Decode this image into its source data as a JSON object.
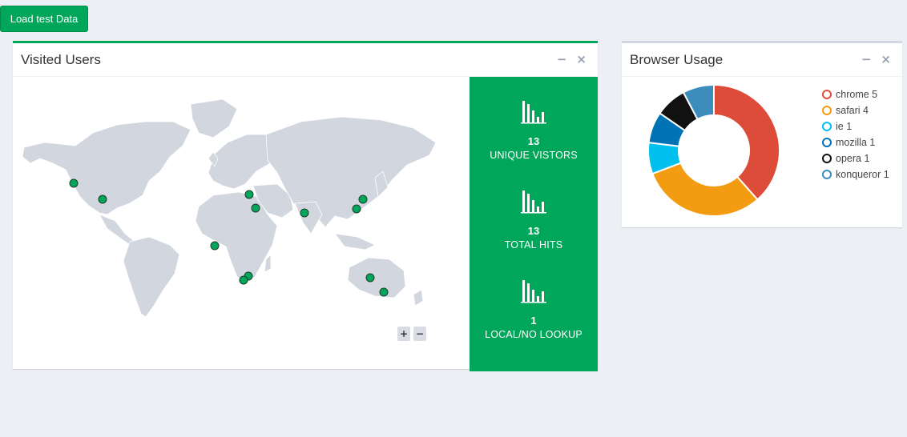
{
  "toolbar": {
    "load_label": "Load test Data"
  },
  "visited": {
    "title": "Visited Users",
    "minimize": "−",
    "close": "×",
    "zoom_in": "+",
    "zoom_out": "−",
    "stats": [
      {
        "value": "13",
        "label": "UNIQUE VISTORS"
      },
      {
        "value": "13",
        "label": "TOTAL HITS"
      },
      {
        "value": "1",
        "label": "LOCAL/NO LOOKUP"
      }
    ],
    "marker_color": "#00a65a"
  },
  "browser": {
    "title": "Browser Usage",
    "minimize": "−",
    "close": "×",
    "legend": [
      {
        "label": "chrome 5",
        "color": "#dd4b39"
      },
      {
        "label": "safari 4",
        "color": "#f39c12"
      },
      {
        "label": "ie 1",
        "color": "#00c0ef"
      },
      {
        "label": "mozilla 1",
        "color": "#0073b7"
      },
      {
        "label": "opera 1",
        "color": "#111111"
      },
      {
        "label": "konqueror 1",
        "color": "#3c8dbc"
      }
    ]
  },
  "chart_data": {
    "type": "pie",
    "categories": [
      "chrome",
      "safari",
      "ie",
      "mozilla",
      "opera",
      "konqueror"
    ],
    "values": [
      5,
      4,
      1,
      1,
      1,
      1
    ],
    "colors": [
      "#dd4b39",
      "#f39c12",
      "#00c0ef",
      "#0073b7",
      "#111111",
      "#3c8dbc"
    ],
    "legend_position": "right"
  }
}
